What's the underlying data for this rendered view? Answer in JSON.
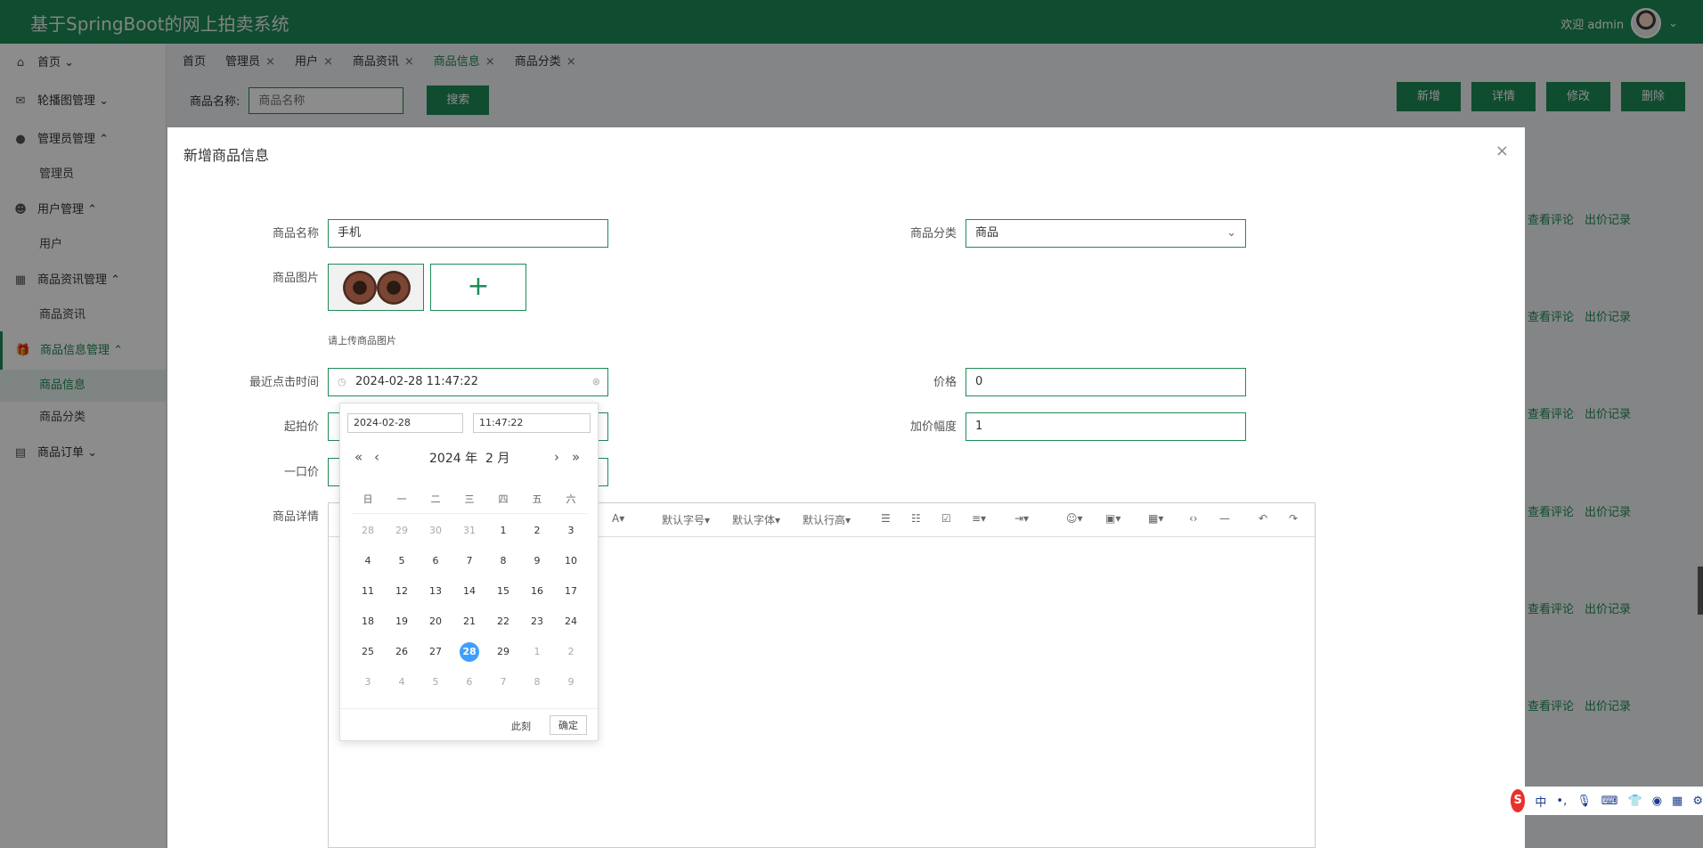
{
  "app": {
    "title": "基于SpringBoot的网上拍卖系统",
    "welcome": "欢迎 admin"
  },
  "sidebar": {
    "items": [
      {
        "label": "首页",
        "icon": "home-icon",
        "expanded": false
      },
      {
        "label": "轮播图管理",
        "icon": "carousel-icon",
        "expanded": false
      },
      {
        "label": "管理员管理",
        "icon": "admin-icon",
        "expanded": true,
        "children": [
          "管理员"
        ]
      },
      {
        "label": "用户管理",
        "icon": "user-icon",
        "expanded": true,
        "children": [
          "用户"
        ]
      },
      {
        "label": "商品资讯管理",
        "icon": "news-icon",
        "expanded": true,
        "children": [
          "商品资讯"
        ]
      },
      {
        "label": "商品信息管理",
        "icon": "gift-icon",
        "expanded": true,
        "active": true,
        "children": [
          "商品信息",
          "商品分类"
        ]
      },
      {
        "label": "商品订单",
        "icon": "order-icon",
        "expanded": false
      }
    ]
  },
  "tabs": [
    {
      "label": "首页",
      "closable": false
    },
    {
      "label": "管理员",
      "closable": true
    },
    {
      "label": "用户",
      "closable": true
    },
    {
      "label": "商品资讯",
      "closable": true
    },
    {
      "label": "商品信息",
      "closable": true,
      "active": true
    },
    {
      "label": "商品分类",
      "closable": true
    }
  ],
  "search": {
    "label": "商品名称:",
    "placeholder": "商品名称",
    "button": "搜索"
  },
  "actions": {
    "add": "新增",
    "detail": "详情",
    "edit": "修改",
    "delete": "删除"
  },
  "row_links": {
    "comments": "查看评论",
    "bids": "出价记录"
  },
  "dialog": {
    "title": "新增商品信息",
    "close": "×",
    "fields": {
      "name": {
        "label": "商品名称",
        "value": "手机"
      },
      "category": {
        "label": "商品分类",
        "value": "商品"
      },
      "image": {
        "label": "商品图片",
        "hint": "请上传商品图片",
        "upload": "+"
      },
      "last_click": {
        "label": "最近点击时间",
        "value": "2024-02-28 11:47:22"
      },
      "price": {
        "label": "价格",
        "value": "0"
      },
      "start_price": {
        "label": "起拍价"
      },
      "increment": {
        "label": "加价幅度",
        "value": "1"
      },
      "buyout": {
        "label": "一口价"
      },
      "detail": {
        "label": "商品详情"
      }
    },
    "editor_toolbar": [
      "默认字号",
      "默认字体",
      "默认行高"
    ]
  },
  "datepicker": {
    "date_input": "2024-02-28",
    "time_input": "11:47:22",
    "year_label": "2024 年",
    "month_label": "2 月",
    "weekdays": [
      "日",
      "一",
      "二",
      "三",
      "四",
      "五",
      "六"
    ],
    "days": [
      [
        "28",
        "29",
        "30",
        "31",
        "1",
        "2",
        "3"
      ],
      [
        "4",
        "5",
        "6",
        "7",
        "8",
        "9",
        "10"
      ],
      [
        "11",
        "12",
        "13",
        "14",
        "15",
        "16",
        "17"
      ],
      [
        "18",
        "19",
        "20",
        "21",
        "22",
        "23",
        "24"
      ],
      [
        "25",
        "26",
        "27",
        "28",
        "29",
        "1",
        "2"
      ],
      [
        "3",
        "4",
        "5",
        "6",
        "7",
        "8",
        "9"
      ]
    ],
    "selected_day": "28",
    "now": "此刻",
    "ok": "确定"
  },
  "ime": {
    "logo": "S",
    "lang": "中",
    "punct": "•,"
  }
}
